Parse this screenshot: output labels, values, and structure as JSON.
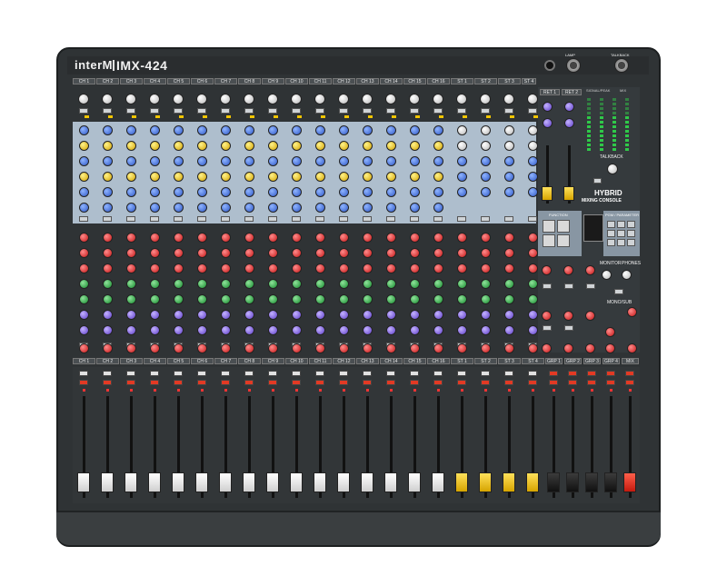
{
  "brand": {
    "maker": "interM",
    "model": "IMX-424"
  },
  "channels": {
    "mono": [
      "CH 1",
      "CH 2",
      "CH 3",
      "CH 4",
      "CH 5",
      "CH 6",
      "CH 7",
      "CH 8",
      "CH 9",
      "CH 10",
      "CH 11",
      "CH 12",
      "CH 13",
      "CH 14",
      "CH 15",
      "CH 16"
    ],
    "stereo": [
      "ST 1",
      "ST 2",
      "ST 3",
      "ST 4"
    ],
    "returns": [
      "RET 1",
      "RET 2"
    ],
    "groups": [
      "GRP 1",
      "GRP 2",
      "GRP 3",
      "GRP 4"
    ],
    "mix": "MIX"
  },
  "master": {
    "talkback": "TALKBACK",
    "hybrid": "HYBRID",
    "mixing_console": "MIXING CONSOLE",
    "pgm_parameter": "PGM / PARAMETER",
    "function": "FUNCTION",
    "monitor": "MONITOR",
    "phones": "PHONES",
    "mono_sub": "MONO/SUB",
    "signal_indicator": "SIGNAL/PEAK",
    "lamp": "LAMP",
    "talkback_mic": "TALKBACK"
  },
  "colors": {
    "body": "#2f3335",
    "eq_panel": "#aebecd",
    "knob_red": "#c41414",
    "knob_green": "#158a2d",
    "knob_blue": "#2f58c6",
    "knob_purple": "#5c3dc8",
    "knob_yellow": "#d4a300"
  }
}
